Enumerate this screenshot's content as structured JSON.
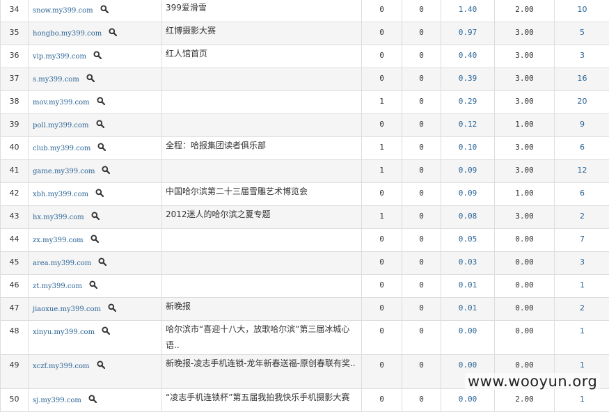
{
  "rows": [
    {
      "rank": "34",
      "domain": "snow.my399.com",
      "title": "399爱滑雪",
      "c1": "0",
      "c2": "0",
      "c3": "1.40",
      "c4": "2.00",
      "c5": "10"
    },
    {
      "rank": "35",
      "domain": "hongbo.my399.com",
      "title": "红博摄影大赛",
      "c1": "0",
      "c2": "0",
      "c3": "0.97",
      "c4": "3.00",
      "c5": "5"
    },
    {
      "rank": "36",
      "domain": "vip.my399.com",
      "title": "红人馆首页",
      "c1": "0",
      "c2": "0",
      "c3": "0.40",
      "c4": "3.00",
      "c5": "3"
    },
    {
      "rank": "37",
      "domain": "s.my399.com",
      "title": "",
      "c1": "0",
      "c2": "0",
      "c3": "0.39",
      "c4": "3.00",
      "c5": "16"
    },
    {
      "rank": "38",
      "domain": "mov.my399.com",
      "title": "",
      "c1": "1",
      "c2": "0",
      "c3": "0.29",
      "c4": "3.00",
      "c5": "20"
    },
    {
      "rank": "39",
      "domain": "poll.my399.com",
      "title": "",
      "c1": "0",
      "c2": "0",
      "c3": "0.12",
      "c4": "1.00",
      "c5": "9"
    },
    {
      "rank": "40",
      "domain": "club.my399.com",
      "title": "全程：哈报集团读者俱乐部",
      "c1": "1",
      "c2": "0",
      "c3": "0.10",
      "c4": "3.00",
      "c5": "6"
    },
    {
      "rank": "41",
      "domain": "game.my399.com",
      "title": "",
      "c1": "1",
      "c2": "0",
      "c3": "0.09",
      "c4": "3.00",
      "c5": "12"
    },
    {
      "rank": "42",
      "domain": "xbh.my399.com",
      "title": "中国哈尔滨第二十三届雪雕艺术博览会",
      "c1": "0",
      "c2": "0",
      "c3": "0.09",
      "c4": "1.00",
      "c5": "6"
    },
    {
      "rank": "43",
      "domain": "hx.my399.com",
      "title": "2012迷人的哈尔滨之夏专题",
      "c1": "1",
      "c2": "0",
      "c3": "0.08",
      "c4": "3.00",
      "c5": "2"
    },
    {
      "rank": "44",
      "domain": "zx.my399.com",
      "title": "",
      "c1": "0",
      "c2": "0",
      "c3": "0.05",
      "c4": "0.00",
      "c5": "7"
    },
    {
      "rank": "45",
      "domain": "area.my399.com",
      "title": "",
      "c1": "0",
      "c2": "0",
      "c3": "0.03",
      "c4": "0.00",
      "c5": "3"
    },
    {
      "rank": "46",
      "domain": "zt.my399.com",
      "title": "",
      "c1": "0",
      "c2": "0",
      "c3": "0.01",
      "c4": "0.00",
      "c5": "1"
    },
    {
      "rank": "47",
      "domain": "jiaoxue.my399.com",
      "title": "新晚报",
      "c1": "0",
      "c2": "0",
      "c3": "0.01",
      "c4": "0.00",
      "c5": "2"
    },
    {
      "rank": "48",
      "domain": "xinyu.my399.com",
      "title": "哈尔滨市“喜迎十八大，放歌哈尔滨”第三届冰城心语..",
      "c1": "0",
      "c2": "0",
      "c3": "0.00",
      "c4": "0.00",
      "c5": "1"
    },
    {
      "rank": "49",
      "domain": "xczf.my399.com",
      "title": "新晚报-凌志手机连锁-龙年新春送福-原创春联有奖..",
      "c1": "0",
      "c2": "0",
      "c3": "0.00",
      "c4": "0.00",
      "c5": "1"
    },
    {
      "rank": "50",
      "domain": "sj.my399.com",
      "title": "“凌志手机连锁杯”第五届我拍我快乐手机摄影大赛",
      "c1": "0",
      "c2": "0",
      "c3": "0.00",
      "c4": "2.00",
      "c5": "1"
    }
  ],
  "watermark": "www.wooyun.org",
  "icons": {
    "search": "magnifier-icon"
  }
}
